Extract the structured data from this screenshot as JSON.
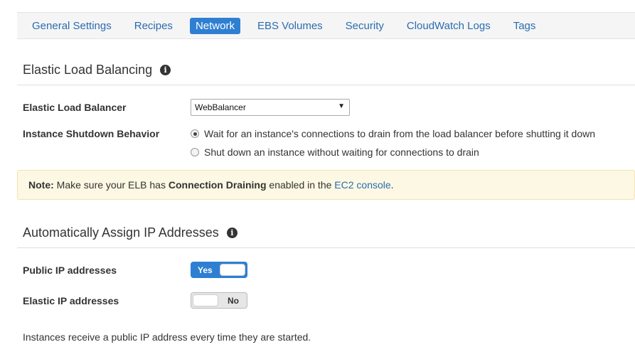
{
  "tabs": [
    {
      "label": "General Settings",
      "active": false
    },
    {
      "label": "Recipes",
      "active": false
    },
    {
      "label": "Network",
      "active": true
    },
    {
      "label": "EBS Volumes",
      "active": false
    },
    {
      "label": "Security",
      "active": false
    },
    {
      "label": "CloudWatch Logs",
      "active": false
    },
    {
      "label": "Tags",
      "active": false
    }
  ],
  "elb_section": {
    "title": "Elastic Load Balancing",
    "elb_label": "Elastic Load Balancer",
    "elb_value": "WebBalancer",
    "shutdown_label": "Instance Shutdown Behavior",
    "options": [
      {
        "label": "Wait for an instance's connections to drain from the load balancer before shutting it down",
        "checked": true
      },
      {
        "label": "Shut down an instance without waiting for connections to drain",
        "checked": false
      }
    ]
  },
  "note": {
    "prefix": "Note:",
    "text1": " Make sure your ELB has ",
    "bold": "Connection Draining",
    "text2": " enabled in the ",
    "link": "EC2 console",
    "suffix": "."
  },
  "ip_section": {
    "title": "Automatically Assign IP Addresses",
    "public_label": "Public IP addresses",
    "public_value": "Yes",
    "elastic_label": "Elastic IP addresses",
    "elastic_value": "No",
    "help_text": "Instances receive a public IP address every time they are started."
  },
  "colors": {
    "accent": "#2e7fd1",
    "link": "#2b6cb0",
    "note_bg": "#fcf8e3"
  }
}
